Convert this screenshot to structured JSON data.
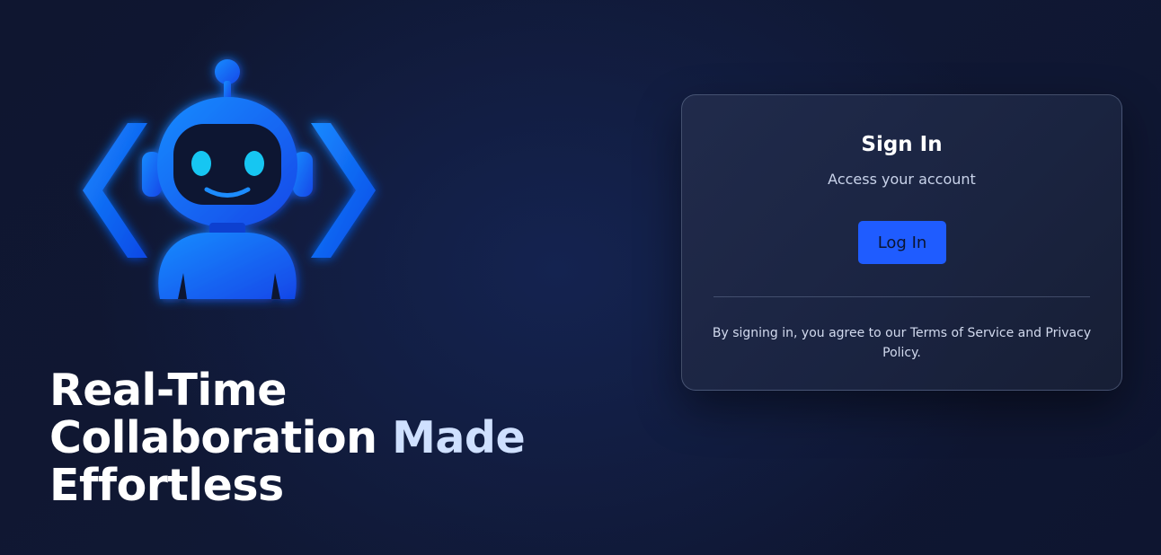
{
  "brand": {
    "logo_icon": "robot-code-brackets-icon",
    "accent_color": "#1f5cff",
    "logo_gradient": [
      "#1a8cff",
      "#1147e8"
    ]
  },
  "hero": {
    "heading_line_1": "Real-Time",
    "heading_line_2_a": "Collaboration ",
    "heading_line_2_b": "Made",
    "heading_line_3": "Effortless"
  },
  "login_card": {
    "title": "Sign In",
    "subtitle": "Access your account",
    "login_button_label": "Log In",
    "terms_text": "By signing in, you agree to our Terms of Service and Privacy Policy."
  }
}
